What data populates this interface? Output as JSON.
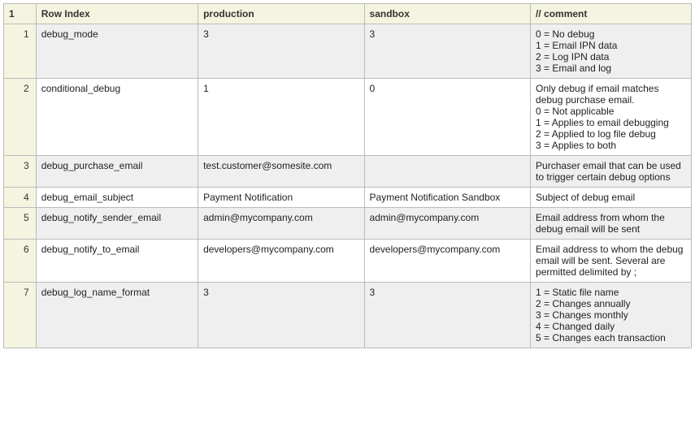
{
  "headers": {
    "corner": "1",
    "rowIndex": "Row Index",
    "production": "production",
    "sandbox": "sandbox",
    "comment": "// comment"
  },
  "rows": [
    {
      "num": "1",
      "rowIndex": "debug_mode",
      "production": "3",
      "sandbox": "3",
      "comment": "0 = No debug\n1 = Email IPN data\n2 = Log IPN data\n3 = Email and log"
    },
    {
      "num": "2",
      "rowIndex": "conditional_debug",
      "production": "1",
      "sandbox": "0",
      "comment": "Only debug if email matches debug purchase email.\n0 = Not applicable\n1 = Applies to email debugging\n2 = Applied to log file debug\n3 = Applies to both"
    },
    {
      "num": "3",
      "rowIndex": "debug_purchase_email",
      "production": "test.customer@somesite.com",
      "sandbox": "",
      "comment": "Purchaser email that can be used to trigger certain debug options"
    },
    {
      "num": "4",
      "rowIndex": "debug_email_subject",
      "production": "Payment Notification",
      "sandbox": "Payment Notification Sandbox",
      "comment": "Subject of debug email"
    },
    {
      "num": "5",
      "rowIndex": "debug_notify_sender_email",
      "production": "admin@mycompany.com",
      "sandbox": "admin@mycompany.com",
      "comment": "Email address from whom the debug email will be sent"
    },
    {
      "num": "6",
      "rowIndex": "debug_notify_to_email",
      "production": "developers@mycompany.com",
      "sandbox": "developers@mycompany.com",
      "comment": "Email address to whom the debug email will be sent. Several are permitted delimited by ;"
    },
    {
      "num": "7",
      "rowIndex": "debug_log_name_format",
      "production": "3",
      "sandbox": "3",
      "comment": "1 = Static file name\n2 = Changes annually\n3 = Changes monthly\n4 = Changed daily\n5 = Changes each transaction"
    }
  ]
}
